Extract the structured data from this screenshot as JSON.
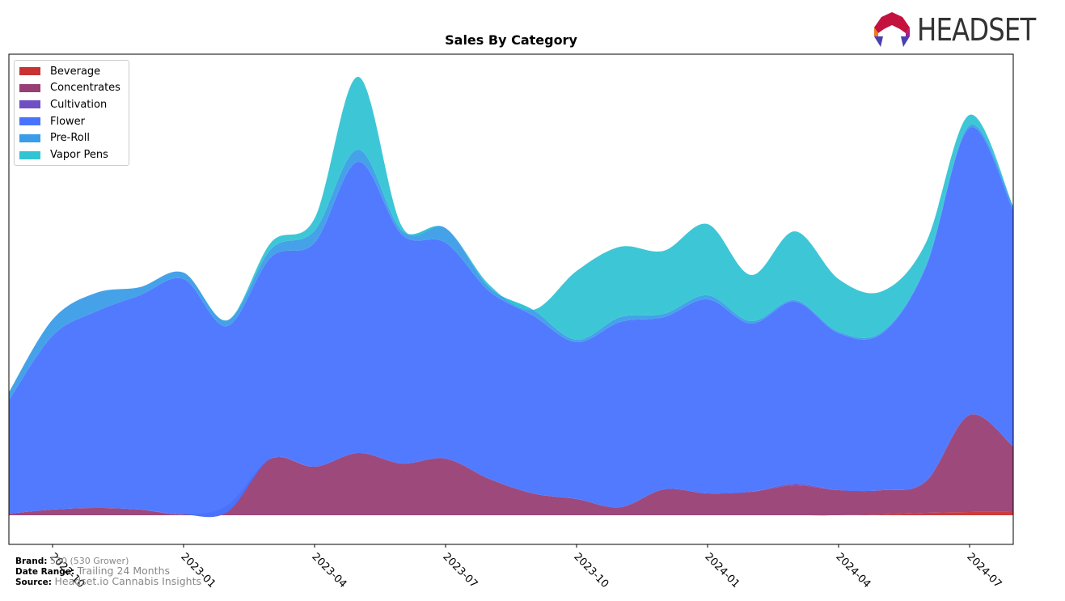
{
  "header": {
    "logo_text": "HEADSET"
  },
  "footer": {
    "brand_label": "Brand:",
    "brand_value": "530 (530 Grower)",
    "date_label": "Date Range:",
    "date_value": "Trailing 24 Months",
    "source_label": "Source:",
    "source_value": "Headset.io Cannabis Insights"
  },
  "chart_data": {
    "type": "area",
    "stacked": true,
    "smoothed": true,
    "title": "Sales By Category",
    "xlabel": "",
    "ylabel": "",
    "legend_position": "top-left",
    "grid": false,
    "y_ticks_shown": false,
    "ylim": [
      -7.2,
      114
    ],
    "x": [
      "2022-09",
      "2022-10",
      "2022-11",
      "2022-12",
      "2023-01",
      "2023-02",
      "2023-03",
      "2023-04",
      "2023-05",
      "2023-06",
      "2023-07",
      "2023-08",
      "2023-09",
      "2023-10",
      "2023-11",
      "2023-12",
      "2024-01",
      "2024-02",
      "2024-03",
      "2024-04",
      "2024-05",
      "2024-06",
      "2024-07",
      "2024-08"
    ],
    "x_tick_labels": [
      "2022-10",
      "2023-01",
      "2023-04",
      "2023-07",
      "2023-10",
      "2024-01",
      "2024-04",
      "2024-07"
    ],
    "series": [
      {
        "name": "Beverage",
        "color": "#c83232",
        "values": [
          0,
          0,
          0,
          0,
          0,
          0,
          0,
          0,
          0,
          0,
          0,
          0,
          0,
          0,
          0,
          0,
          0,
          0,
          0,
          0,
          0.2,
          0.6,
          0.8,
          0.8
        ]
      },
      {
        "name": "Concentrates",
        "color": "#983f75",
        "values": [
          0.4,
          1.4,
          1.8,
          1.4,
          0.2,
          2.4,
          14,
          12,
          15.4,
          12.8,
          14,
          9,
          5.4,
          4,
          2,
          6.4,
          5.4,
          5.8,
          7.4,
          6.2,
          6.0,
          7.8,
          24,
          16.2
        ]
      },
      {
        "name": "Cultivation",
        "color": "#6e4fc4",
        "values": [
          0,
          0,
          0,
          0,
          0,
          -1.6,
          0,
          0,
          0,
          0,
          0,
          0,
          0,
          0,
          0,
          0,
          0,
          0,
          0.4,
          0,
          0,
          0,
          0,
          0
        ]
      },
      {
        "name": "Flower",
        "color": "#4873ff",
        "values": [
          28,
          43,
          48.6,
          53,
          58.2,
          46,
          49.8,
          55.4,
          72,
          56.6,
          53.4,
          46.4,
          44,
          38.8,
          45.8,
          42.6,
          48,
          41.6,
          45,
          38.8,
          38.8,
          53,
          71,
          58.4
        ]
      },
      {
        "name": "Pre-Roll",
        "color": "#3b9de8",
        "values": [
          2,
          4,
          4.6,
          2,
          1.6,
          1.4,
          2,
          3,
          3,
          1,
          3.6,
          1,
          1.4,
          0.6,
          1.2,
          0.8,
          1,
          0.6,
          0.4,
          0.4,
          0.4,
          0.4,
          0.6,
          1
        ]
      },
      {
        "name": "Vapor Pens",
        "color": "#33c4d4",
        "values": [
          0,
          0,
          0,
          0,
          0,
          0,
          1.6,
          3,
          18,
          1,
          0,
          0.6,
          0,
          17,
          17.4,
          15.6,
          17.6,
          11.4,
          17,
          13,
          10,
          5.6,
          2.6,
          0
        ]
      }
    ]
  }
}
